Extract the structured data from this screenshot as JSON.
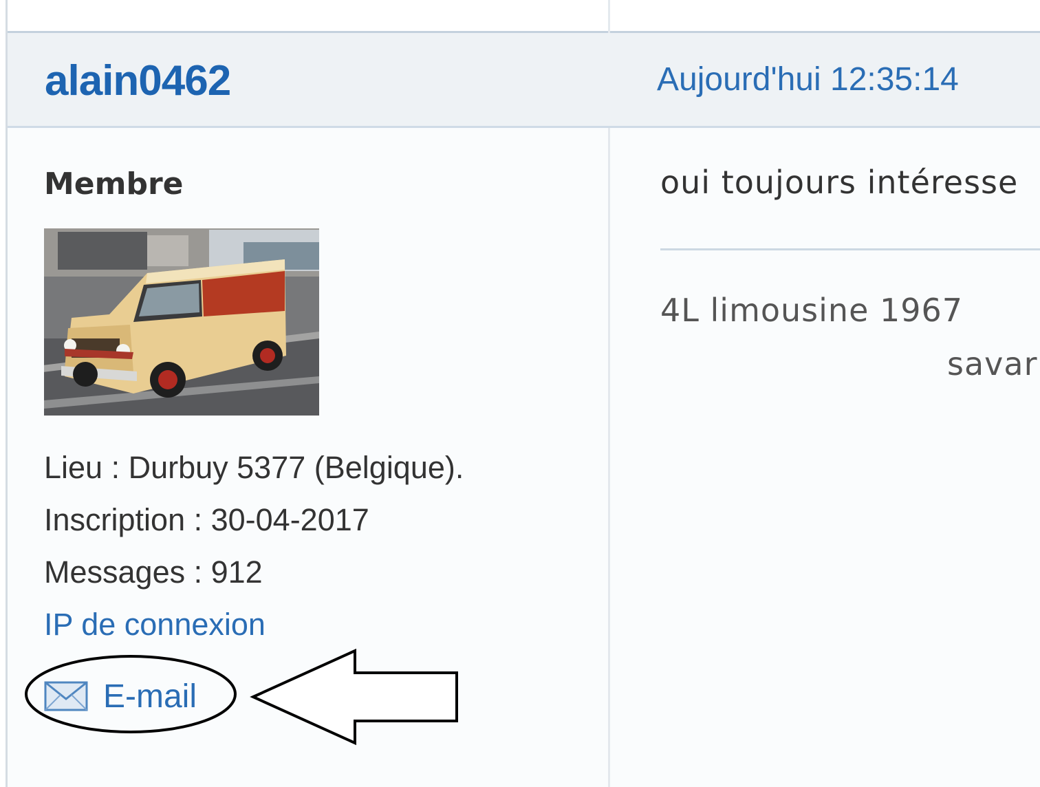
{
  "post": {
    "author": "alain0462",
    "date": "Aujourd'hui 12:35:14",
    "message": "oui toujours intéresse",
    "signature_line1": "4L limousine 1967",
    "signature_line2": "savar"
  },
  "profile": {
    "rank": "Membre",
    "location": "Lieu : Durbuy 5377 (Belgique).",
    "registration": "Inscription : 30-04-2017",
    "messages": "Messages : 912",
    "ip_link": "IP de connexion",
    "email_link": "E-mail",
    "avatar_icon": "car-avatar-image"
  },
  "colors": {
    "link": "#2a6db5",
    "author": "#1d64b1",
    "header_bg": "#eef2f5",
    "panel_bg": "#fafcfd"
  }
}
